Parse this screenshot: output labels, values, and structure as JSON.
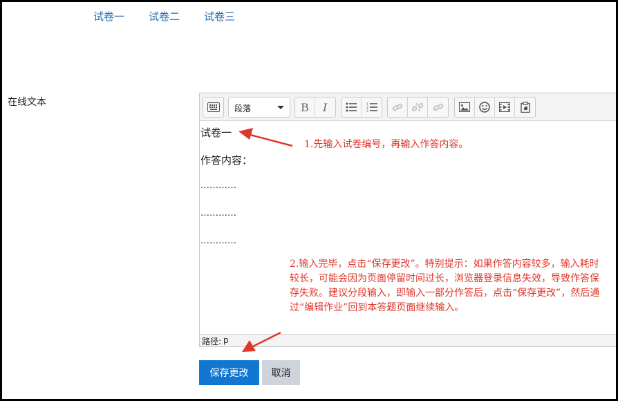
{
  "tabs": [
    {
      "label": "试卷一"
    },
    {
      "label": "试卷二"
    },
    {
      "label": "试卷三"
    }
  ],
  "field": {
    "label": "在线文本"
  },
  "editor": {
    "format_value": "段落",
    "content_lines": [
      "试卷一",
      "作答内容：",
      "…………",
      "…………",
      "…………"
    ],
    "status_label": "路径:",
    "status_path": "p",
    "toolbar_icons": [
      "keyboard-icon",
      "bold-icon",
      "italic-icon",
      "bullet-list-icon",
      "numbered-list-icon",
      "link-icon",
      "unlink-icon",
      "anchor-link-icon",
      "image-icon",
      "emoticon-icon",
      "media-icon",
      "paste-icon"
    ]
  },
  "annotations": {
    "note1": "1.先输入试卷编号，再输入作答内容。",
    "note2": "2.输入完毕，点击“保存更改”。特别提示：如果作答内容较多，输入耗时较长，可能会因为页面停留时间过长，浏览器登录信息失效，导致作答保存失败。建议分段输入，即输入一部分作答后，点击“保存更改”，然后通过“编辑作业”回到本答题页面继续输入。"
  },
  "buttons": {
    "save": "保存更改",
    "cancel": "取消"
  },
  "colors": {
    "tab_link": "#2a6fb0",
    "annotation": "#e0352b",
    "primary_button": "#1177d1",
    "secondary_button": "#ced4da"
  }
}
